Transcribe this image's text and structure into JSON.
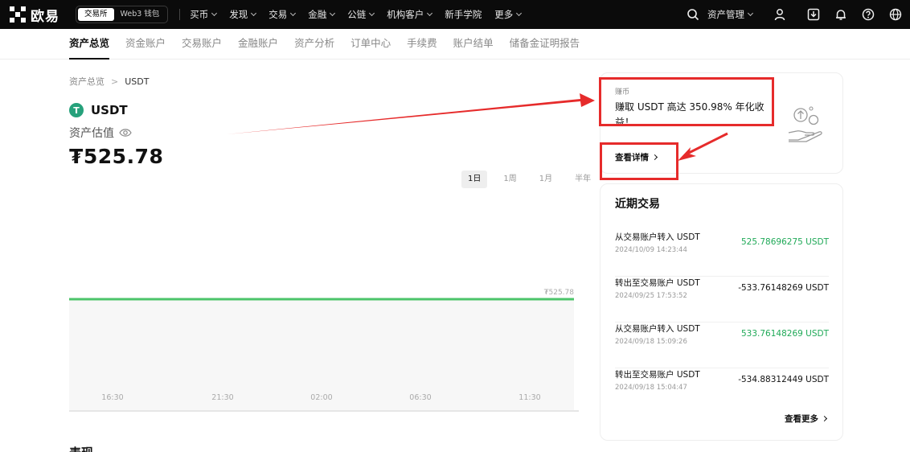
{
  "topbar": {
    "brand": "欧易",
    "switch": [
      "交易所",
      "Web3 钱包"
    ],
    "nav": [
      "买币",
      "发现",
      "交易",
      "金融",
      "公链",
      "机构客户",
      "新手学院",
      "更多"
    ],
    "asset_mgmt": "资产管理"
  },
  "subnav": [
    "资产总览",
    "资金账户",
    "交易账户",
    "金融账户",
    "资产分析",
    "订单中心",
    "手续费",
    "账户结单",
    "储备金证明报告"
  ],
  "breadcrumb": {
    "parent": "资产总览",
    "sep": ">",
    "current": "USDT"
  },
  "coin": {
    "symbol": "T",
    "name": "USDT"
  },
  "valuation": {
    "label": "资产估值",
    "amount": "₮525.78"
  },
  "ranges": [
    "1日",
    "1周",
    "1月",
    "半年"
  ],
  "chart_data": {
    "type": "line",
    "x": [
      "16:30",
      "21:30",
      "02:00",
      "06:30",
      "11:30"
    ],
    "values": [
      525.78,
      525.78,
      525.78,
      525.78,
      525.78
    ],
    "end_label": "₮525.78",
    "line_color": "#4cc46a"
  },
  "section_bottom": "表现",
  "promo": {
    "tag": "赚币",
    "title": "赚取 USDT 高达 350.98% 年化收益！",
    "link": "查看详情"
  },
  "recent": {
    "title": "近期交易",
    "items": [
      {
        "name": "从交易账户转入 USDT",
        "time": "2024/10/09 14:23:44",
        "amount": "525.78696275 USDT",
        "positive": true
      },
      {
        "name": "转出至交易账户 USDT",
        "time": "2024/09/25 17:53:52",
        "amount": "-533.76148269 USDT",
        "positive": false
      },
      {
        "name": "从交易账户转入 USDT",
        "time": "2024/09/18 15:09:26",
        "amount": "533.76148269 USDT",
        "positive": true
      },
      {
        "name": "转出至交易账户 USDT",
        "time": "2024/09/18 15:04:47",
        "amount": "-534.88312449 USDT",
        "positive": false
      }
    ],
    "more": "查看更多"
  },
  "colors": {
    "annotation": "#e62b2b",
    "positive": "#1fa957",
    "tether": "#26a17b"
  }
}
